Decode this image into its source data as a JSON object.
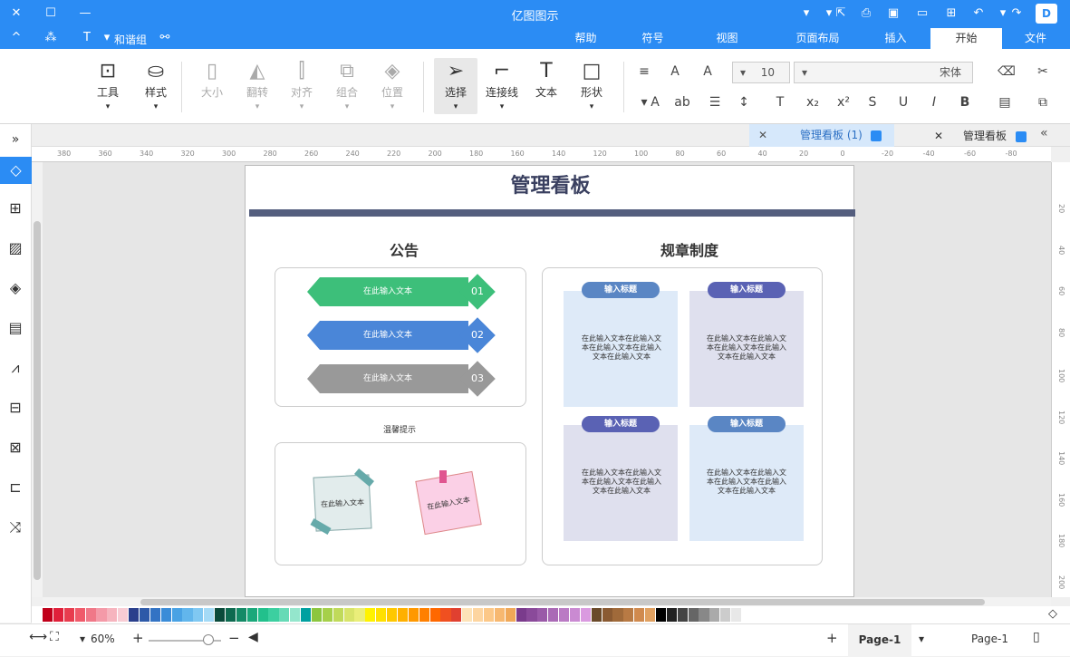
{
  "app": {
    "title": "亿图图示"
  },
  "titlebar": {
    "logo_icon": "d-logo-icon"
  },
  "tabs": [
    "文件",
    "开始",
    "插入",
    "页面布局",
    "视图",
    "符号",
    "帮助"
  ],
  "tabrow_left": {
    "group_label": "和谐组"
  },
  "ribbon": {
    "font_name": "宋体",
    "font_size": "10",
    "groups": {
      "tools": "工具",
      "style": "样式",
      "size": "大小",
      "flip": "翻转",
      "align": "对齐",
      "combine": "组合",
      "position": "位置",
      "select": "选择",
      "connector": "连接线",
      "text": "文本",
      "shape": "形状"
    }
  },
  "doc_tabs": [
    {
      "label": "管理看板",
      "active": false
    },
    {
      "label": "管理看板 (1)",
      "active": true
    }
  ],
  "ruler": {
    "h_ticks": [
      "380",
      "360",
      "340",
      "320",
      "300",
      "280",
      "260",
      "240",
      "220",
      "200",
      "180",
      "160",
      "140",
      "120",
      "100",
      "80",
      "60",
      "40",
      "20",
      "0",
      "-20",
      "-40",
      "-60",
      "-80"
    ],
    "v_ticks": [
      "20",
      "40",
      "60",
      "80",
      "100",
      "120",
      "140",
      "160",
      "180",
      "200"
    ]
  },
  "board": {
    "title": "管理看板",
    "section_right": "规章制度",
    "section_left": "公告",
    "notes": [
      {
        "title": "输入标题",
        "body": "在此输入文本在此输入文本在此输入文本在此输入文本在此输入文本"
      },
      {
        "title": "输入标题",
        "body": "在此输入文本在此输入文本在此输入文本在此输入文本在此输入文本"
      },
      {
        "title": "输入标题",
        "body": "在此输入文本在此输入文本在此输入文本在此输入文本在此输入文本"
      },
      {
        "title": "输入标题",
        "body": "在此输入文本在此输入文本在此输入文本在此输入文本在此输入文本"
      }
    ],
    "arrows": [
      {
        "num": "01",
        "text": "在此输入文本",
        "color": "#3dbf7a"
      },
      {
        "num": "02",
        "text": "在此输入文本",
        "color": "#4a86d8"
      },
      {
        "num": "03",
        "text": "在此输入文本",
        "color": "#999999"
      }
    ],
    "reminder_title": "温馨提示",
    "stickies": [
      "在此输入文本",
      "在此输入文本"
    ]
  },
  "status": {
    "page_selector": "Page-1",
    "page_tab": "Page-1",
    "zoom": "60%"
  },
  "palette": [
    "#c0001a",
    "#e0203a",
    "#e83c4e",
    "#f05a6a",
    "#f07888",
    "#f49aa8",
    "#f6b4be",
    "#f8ccd4",
    "#2a3f8c",
    "#2d59a8",
    "#3373c4",
    "#3a8cd8",
    "#49a2e4",
    "#62b6ec",
    "#80c8f2",
    "#a4daf6",
    "#0a4a3a",
    "#0e6a50",
    "#148a66",
    "#1aa87a",
    "#22c08c",
    "#3ccfa0",
    "#66dab6",
    "#94e6cc",
    "#00a0a0",
    "#8cc63f",
    "#a6d04a",
    "#c0da5a",
    "#d8e46a",
    "#eaee7a",
    "#fff200",
    "#ffe000",
    "#ffc800",
    "#ffb000",
    "#ff9800",
    "#ff8000",
    "#ff6800",
    "#f05020",
    "#e04030",
    "#fde3b8",
    "#fdd5a0",
    "#fcc888",
    "#f7b870",
    "#f0a858",
    "#7a3b8c",
    "#8a4a9a",
    "#9a5aa8",
    "#aa6ab6",
    "#ba7ac4",
    "#ca8ad2",
    "#da9ae0",
    "#6a4a2a",
    "#8a5a32",
    "#a06a3a",
    "#b87a44",
    "#d08a4e",
    "#e0a060",
    "#000000",
    "#222222",
    "#444444",
    "#666666",
    "#888888",
    "#aaaaaa",
    "#cccccc",
    "#e8e8e8"
  ]
}
